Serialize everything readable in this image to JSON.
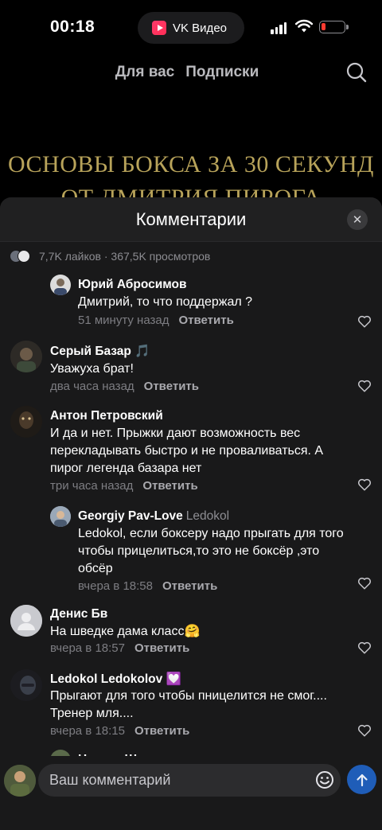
{
  "status_bar": {
    "time": "00:18",
    "app_pill_label": "VK Видео"
  },
  "top_tabs": [
    {
      "label": "Для вас"
    },
    {
      "label": "Подписки"
    }
  ],
  "video": {
    "title_line1": "ОСНОВЫ БОКСА ЗА 30 СЕКУНД",
    "title_line2": "ОТ ДМИТРИЯ ПИРОГА"
  },
  "comments_sheet": {
    "title": "Комментарии",
    "stats": "7,7K лайков · 367,5K просмотров",
    "reply_label": "Ответить",
    "comments": [
      {
        "author": "Юрий Абросимов",
        "lines": [
          "Дмитрий, то что поддержал ?"
        ],
        "time": "51 минуту назад",
        "reply": true
      },
      {
        "author": "Серый Базар",
        "badge": "🎵",
        "lines": [
          "Уважуха брат!"
        ],
        "time": "два часа назад"
      },
      {
        "author": "Антон Петровский",
        "lines": [
          "И да и нет. Прыжки дают возможность вес",
          "перекладывать быстро и не проваливаться. А",
          "пирог легенда базара нет"
        ],
        "time": "три часа назад"
      },
      {
        "author": "Georgiy Pav-Love",
        "reply_to": "Ledokol",
        "lines": [
          "Ledokol, если боксеру надо прыгать для того",
          "чтобы прицелиться,то это не боксёр ,это",
          "обсёр"
        ],
        "time": "вчера в 18:58",
        "reply": true
      },
      {
        "author": "Денис Бв",
        "lines": [
          "На шведке дама класс🤗"
        ],
        "time": "вчера в 18:57"
      },
      {
        "author": "Ledokol Ledokolov",
        "badge": "💟",
        "lines": [
          "Прыгают для того чтобы пницелится не смог....",
          "Тренер мля...."
        ],
        "time": "вчера в 18:15"
      },
      {
        "author": "Никита Шомин",
        "lines": [],
        "time": ""
      }
    ]
  },
  "composer": {
    "placeholder": "Ваш комментарий"
  },
  "colors": {
    "accent_send": "#1f5db8",
    "video_title": "#b8a35a",
    "sheet_bg": "#19191a"
  }
}
